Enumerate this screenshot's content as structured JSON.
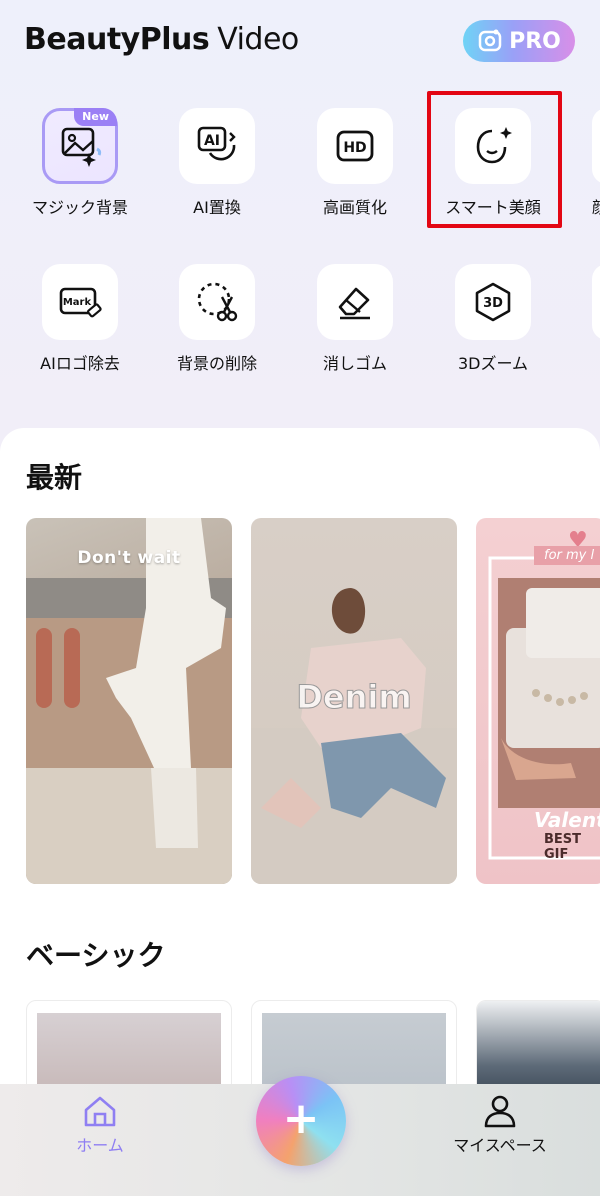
{
  "header": {
    "brand_bold": "BeautyPlus",
    "brand_light": "Video",
    "pro_label": "PRO"
  },
  "tools_row1": [
    {
      "label": "マジック背景",
      "badge": "New"
    },
    {
      "label": "AI置換"
    },
    {
      "label": "高画質化"
    },
    {
      "label": "スマート美顔"
    },
    {
      "label": "顔"
    }
  ],
  "tools_row2": [
    {
      "label": "AIロゴ除去"
    },
    {
      "label": "背景の削除"
    },
    {
      "label": "消しゴム"
    },
    {
      "label": "3Dズーム"
    }
  ],
  "icon_texts": {
    "ai": "AI",
    "hd": "HD",
    "mark": "Mark",
    "three_d": "3D"
  },
  "sections": {
    "latest": "最新",
    "basic": "ベーシック"
  },
  "latest_cards": [
    {
      "caption": "Don't wait"
    },
    {
      "caption": "Denim"
    },
    {
      "caption_top": "for my l",
      "caption_mid": "Valentin",
      "caption_bottom": "BEST GIF"
    }
  ],
  "nav": {
    "home_label": "ホーム",
    "me_label": "マイスペース",
    "fab_label": "+"
  },
  "colors": {
    "accent_purple": "#8f7ff2",
    "highlight_red": "#e30613",
    "badge_purple": "#9b80f5"
  }
}
